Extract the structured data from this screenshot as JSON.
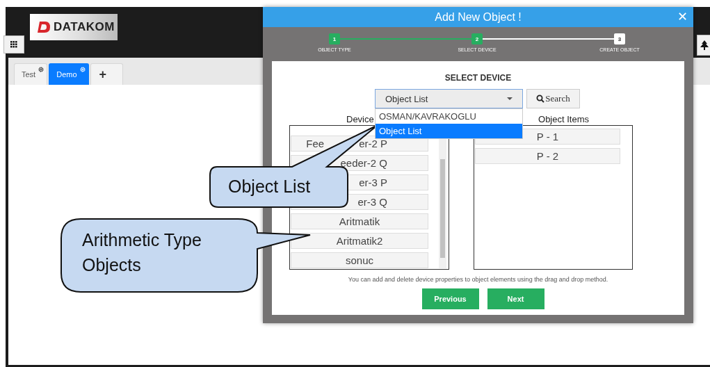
{
  "header": {
    "logo": {
      "text": "DATAKOM"
    }
  },
  "tabs": [
    {
      "label": "Test",
      "selected": false,
      "kind": "tab"
    },
    {
      "label": "Demo",
      "selected": true,
      "kind": "tab"
    },
    {
      "label": "+",
      "selected": false,
      "kind": "add"
    }
  ],
  "dialog": {
    "title": "Add New Object !",
    "close": "✕",
    "steps": [
      {
        "number": "1",
        "label": "OBJECT TYPE",
        "active": true
      },
      {
        "number": "2",
        "label": "SELECT DEVICE",
        "active": true
      },
      {
        "number": "3",
        "label": "CREATE OBJECT",
        "active": false
      }
    ],
    "heading": "SELECT DEVICE",
    "device_select": {
      "value": "Object List",
      "expanded": true,
      "options": [
        {
          "label": "OSMAN/KAVRAKOGLU",
          "selected": false
        },
        {
          "label": "Object List",
          "selected": true
        }
      ]
    },
    "search_button": "Search",
    "devices": {
      "header": "Device",
      "items": [
        "Fee            er-2 P",
        "eeder-2 Q",
        "er-3 P",
        "er-3 Q",
        "Aritmatik",
        "Aritmatik2",
        "sonuc"
      ]
    },
    "object_items": {
      "header": "Object Items",
      "items": [
        "P - 1",
        "P - 2"
      ]
    },
    "hint": "You can add and delete device properties to object elements using the drag and drop method.",
    "buttons": [
      "Previous",
      "Next"
    ]
  },
  "callouts": [
    {
      "text": "Object List"
    },
    {
      "text": "Arithmetic Type Objects"
    }
  ]
}
